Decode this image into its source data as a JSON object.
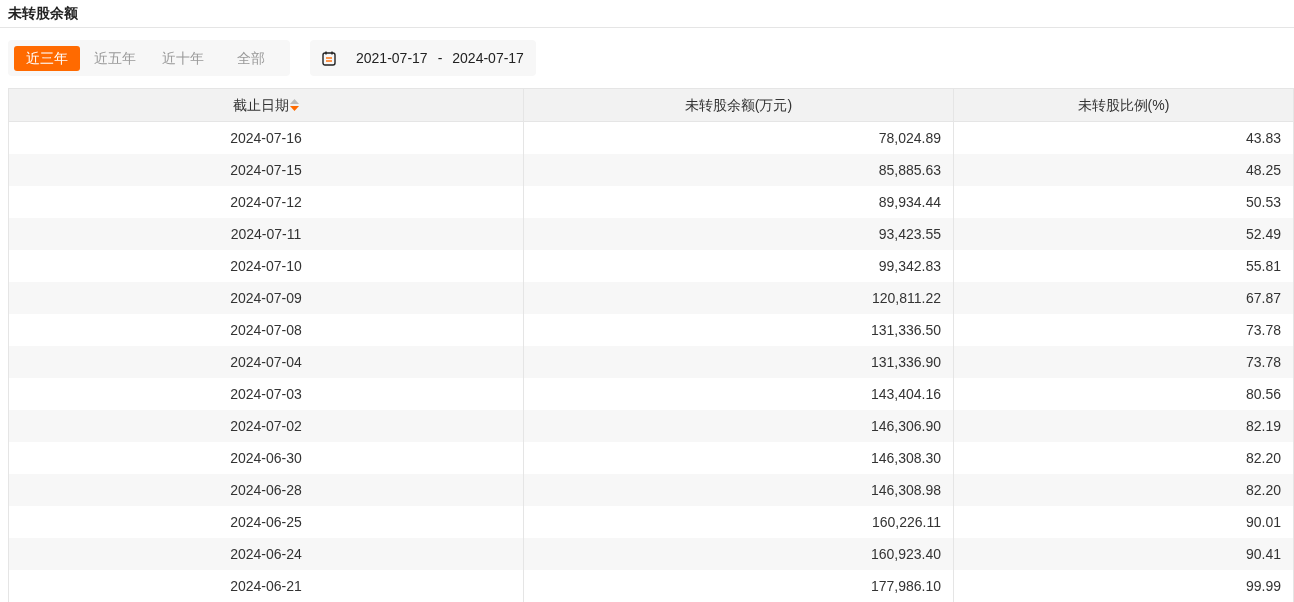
{
  "title": "未转股余额",
  "range_tabs": [
    {
      "label": "近三年",
      "selected": true
    },
    {
      "label": "近五年",
      "selected": false
    },
    {
      "label": "近十年",
      "selected": false
    },
    {
      "label": "全部",
      "selected": false
    }
  ],
  "date_range": {
    "start": "2021-07-17",
    "separator": "-",
    "end": "2024-07-17"
  },
  "table": {
    "columns": [
      {
        "label": "截止日期",
        "sorted": true
      },
      {
        "label": "未转股余额(万元)",
        "sorted": false
      },
      {
        "label": "未转股比例(%)",
        "sorted": false
      }
    ],
    "rows": [
      [
        "2024-07-16",
        "78,024.89",
        "43.83"
      ],
      [
        "2024-07-15",
        "85,885.63",
        "48.25"
      ],
      [
        "2024-07-12",
        "89,934.44",
        "50.53"
      ],
      [
        "2024-07-11",
        "93,423.55",
        "52.49"
      ],
      [
        "2024-07-10",
        "99,342.83",
        "55.81"
      ],
      [
        "2024-07-09",
        "120,811.22",
        "67.87"
      ],
      [
        "2024-07-08",
        "131,336.50",
        "73.78"
      ],
      [
        "2024-07-04",
        "131,336.90",
        "73.78"
      ],
      [
        "2024-07-03",
        "143,404.16",
        "80.56"
      ],
      [
        "2024-07-02",
        "146,306.90",
        "82.19"
      ],
      [
        "2024-06-30",
        "146,308.30",
        "82.20"
      ],
      [
        "2024-06-28",
        "146,308.98",
        "82.20"
      ],
      [
        "2024-06-25",
        "160,226.11",
        "90.01"
      ],
      [
        "2024-06-24",
        "160,923.40",
        "90.41"
      ],
      [
        "2024-06-21",
        "177,986.10",
        "99.99"
      ]
    ]
  }
}
